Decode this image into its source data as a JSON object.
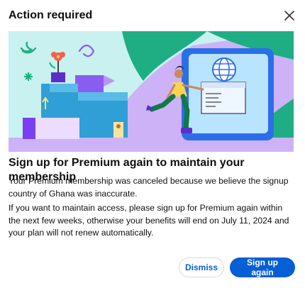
{
  "dialog": {
    "title": "Action required",
    "close_icon": "close-icon"
  },
  "banner": {
    "description_icons": [
      "globe-icon",
      "person-illustration",
      "boxes-illustration",
      "flower-illustration"
    ],
    "colors": {
      "background": "#c9f1ef",
      "purple": "#c8a6f5",
      "green": "#1fae84",
      "blue": "#2b6fe8",
      "dark_purple": "#7b3ff2"
    }
  },
  "content": {
    "headline": "Sign up for Premium again to maintain your membership",
    "paragraph_1": "Your Premium membership was canceled because we believe the signup country of Ghana was inaccurate.",
    "paragraph_2": "If you want to maintain access, please sign up for Premium again within the next few weeks, otherwise your benefits will end on July 11, 2024 and your plan will not renew automatically."
  },
  "actions": {
    "dismiss_label": "Dismiss",
    "signup_label": "Sign up again"
  },
  "colors": {
    "accent": "#065fd4",
    "text": "#0f0f0f"
  }
}
